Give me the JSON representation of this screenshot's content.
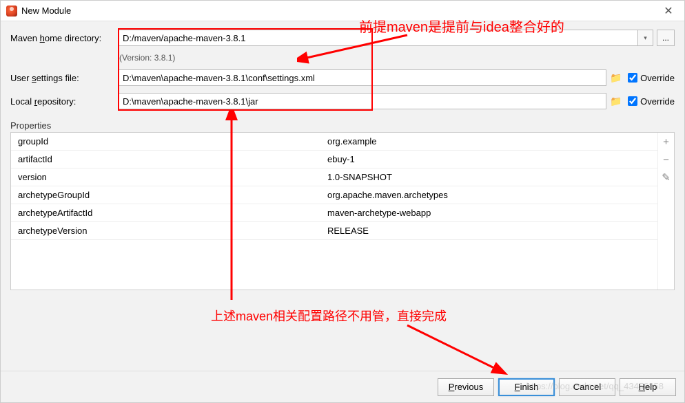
{
  "title": "New Module",
  "annotations": {
    "top": "前提maven是提前与idea整合好的",
    "bottom": "上述maven相关配置路径不用管，直接完成"
  },
  "labels": {
    "maven_home": "Maven home directory:",
    "maven_home_u": "h",
    "user_settings": "User settings file:",
    "user_settings_u": "s",
    "local_repo": "Local repository:",
    "local_repo_u": "r",
    "properties": "Properties",
    "override": "Override"
  },
  "values": {
    "maven_home": "D:/maven/apache-maven-3.8.1",
    "version_note": "(Version: 3.8.1)",
    "user_settings": "D:\\maven\\apache-maven-3.8.1\\conf\\settings.xml",
    "local_repo": "D:\\maven\\apache-maven-3.8.1\\jar"
  },
  "properties": [
    {
      "key": "groupId",
      "value": "org.example"
    },
    {
      "key": "artifactId",
      "value": "ebuy-1"
    },
    {
      "key": "version",
      "value": "1.0-SNAPSHOT"
    },
    {
      "key": "archetypeGroupId",
      "value": "org.apache.maven.archetypes"
    },
    {
      "key": "archetypeArtifactId",
      "value": "maven-archetype-webapp"
    },
    {
      "key": "archetypeVersion",
      "value": "RELEASE"
    }
  ],
  "buttons": {
    "previous": "Previous",
    "previous_u": "P",
    "finish": "Finish",
    "finish_u": "F",
    "cancel": "Cancel",
    "help": "Help",
    "help_u": "H"
  },
  "watermark": "https://blog.csdn.net/qq_43456258"
}
